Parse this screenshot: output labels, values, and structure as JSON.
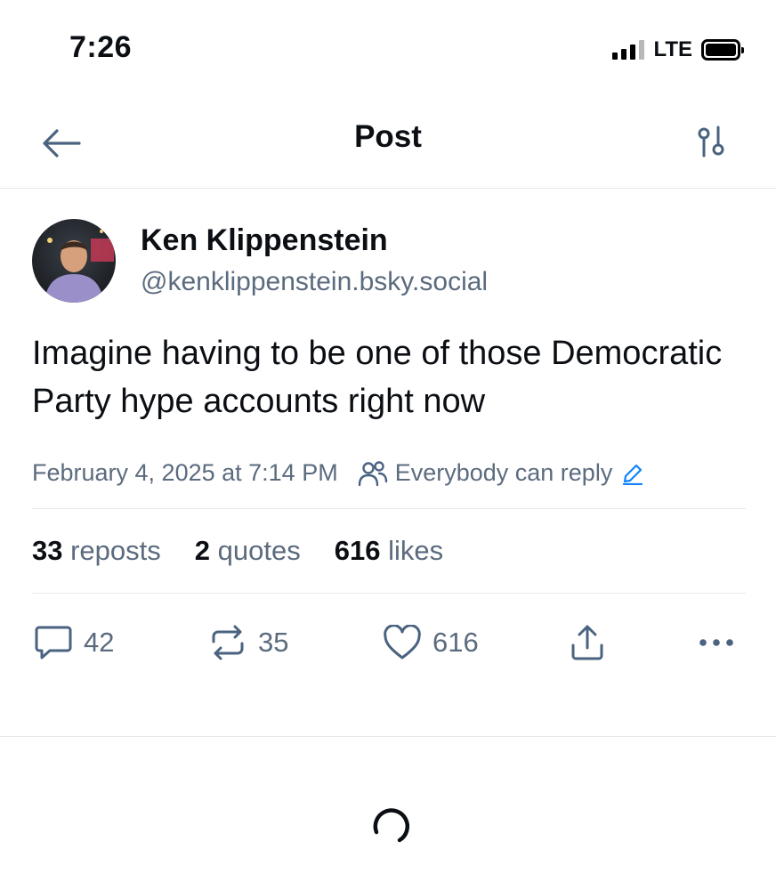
{
  "status_bar": {
    "time": "7:26",
    "network": "LTE"
  },
  "header": {
    "title": "Post",
    "back_icon": "arrow-left-icon",
    "settings_icon": "sliders-icon"
  },
  "post": {
    "author": {
      "name": "Ken Klippenstein",
      "handle": "@kenklippenstein.bsky.social"
    },
    "text": "Imagine having to be one of those Democratic Party hype accounts right now",
    "timestamp": "February 4, 2025 at 7:14 PM",
    "reply_setting": "Everybody can reply",
    "stats": {
      "reposts_count": "33",
      "reposts_label": "reposts",
      "quotes_count": "2",
      "quotes_label": "quotes",
      "likes_count": "616",
      "likes_label": "likes"
    },
    "actions": {
      "reply_count": "42",
      "repost_count": "35",
      "like_count": "616"
    }
  },
  "colors": {
    "accent": "#1083fe",
    "muted_text": "#5b6b7e",
    "icon": "#4a6380",
    "divider": "#e4e8ec"
  }
}
